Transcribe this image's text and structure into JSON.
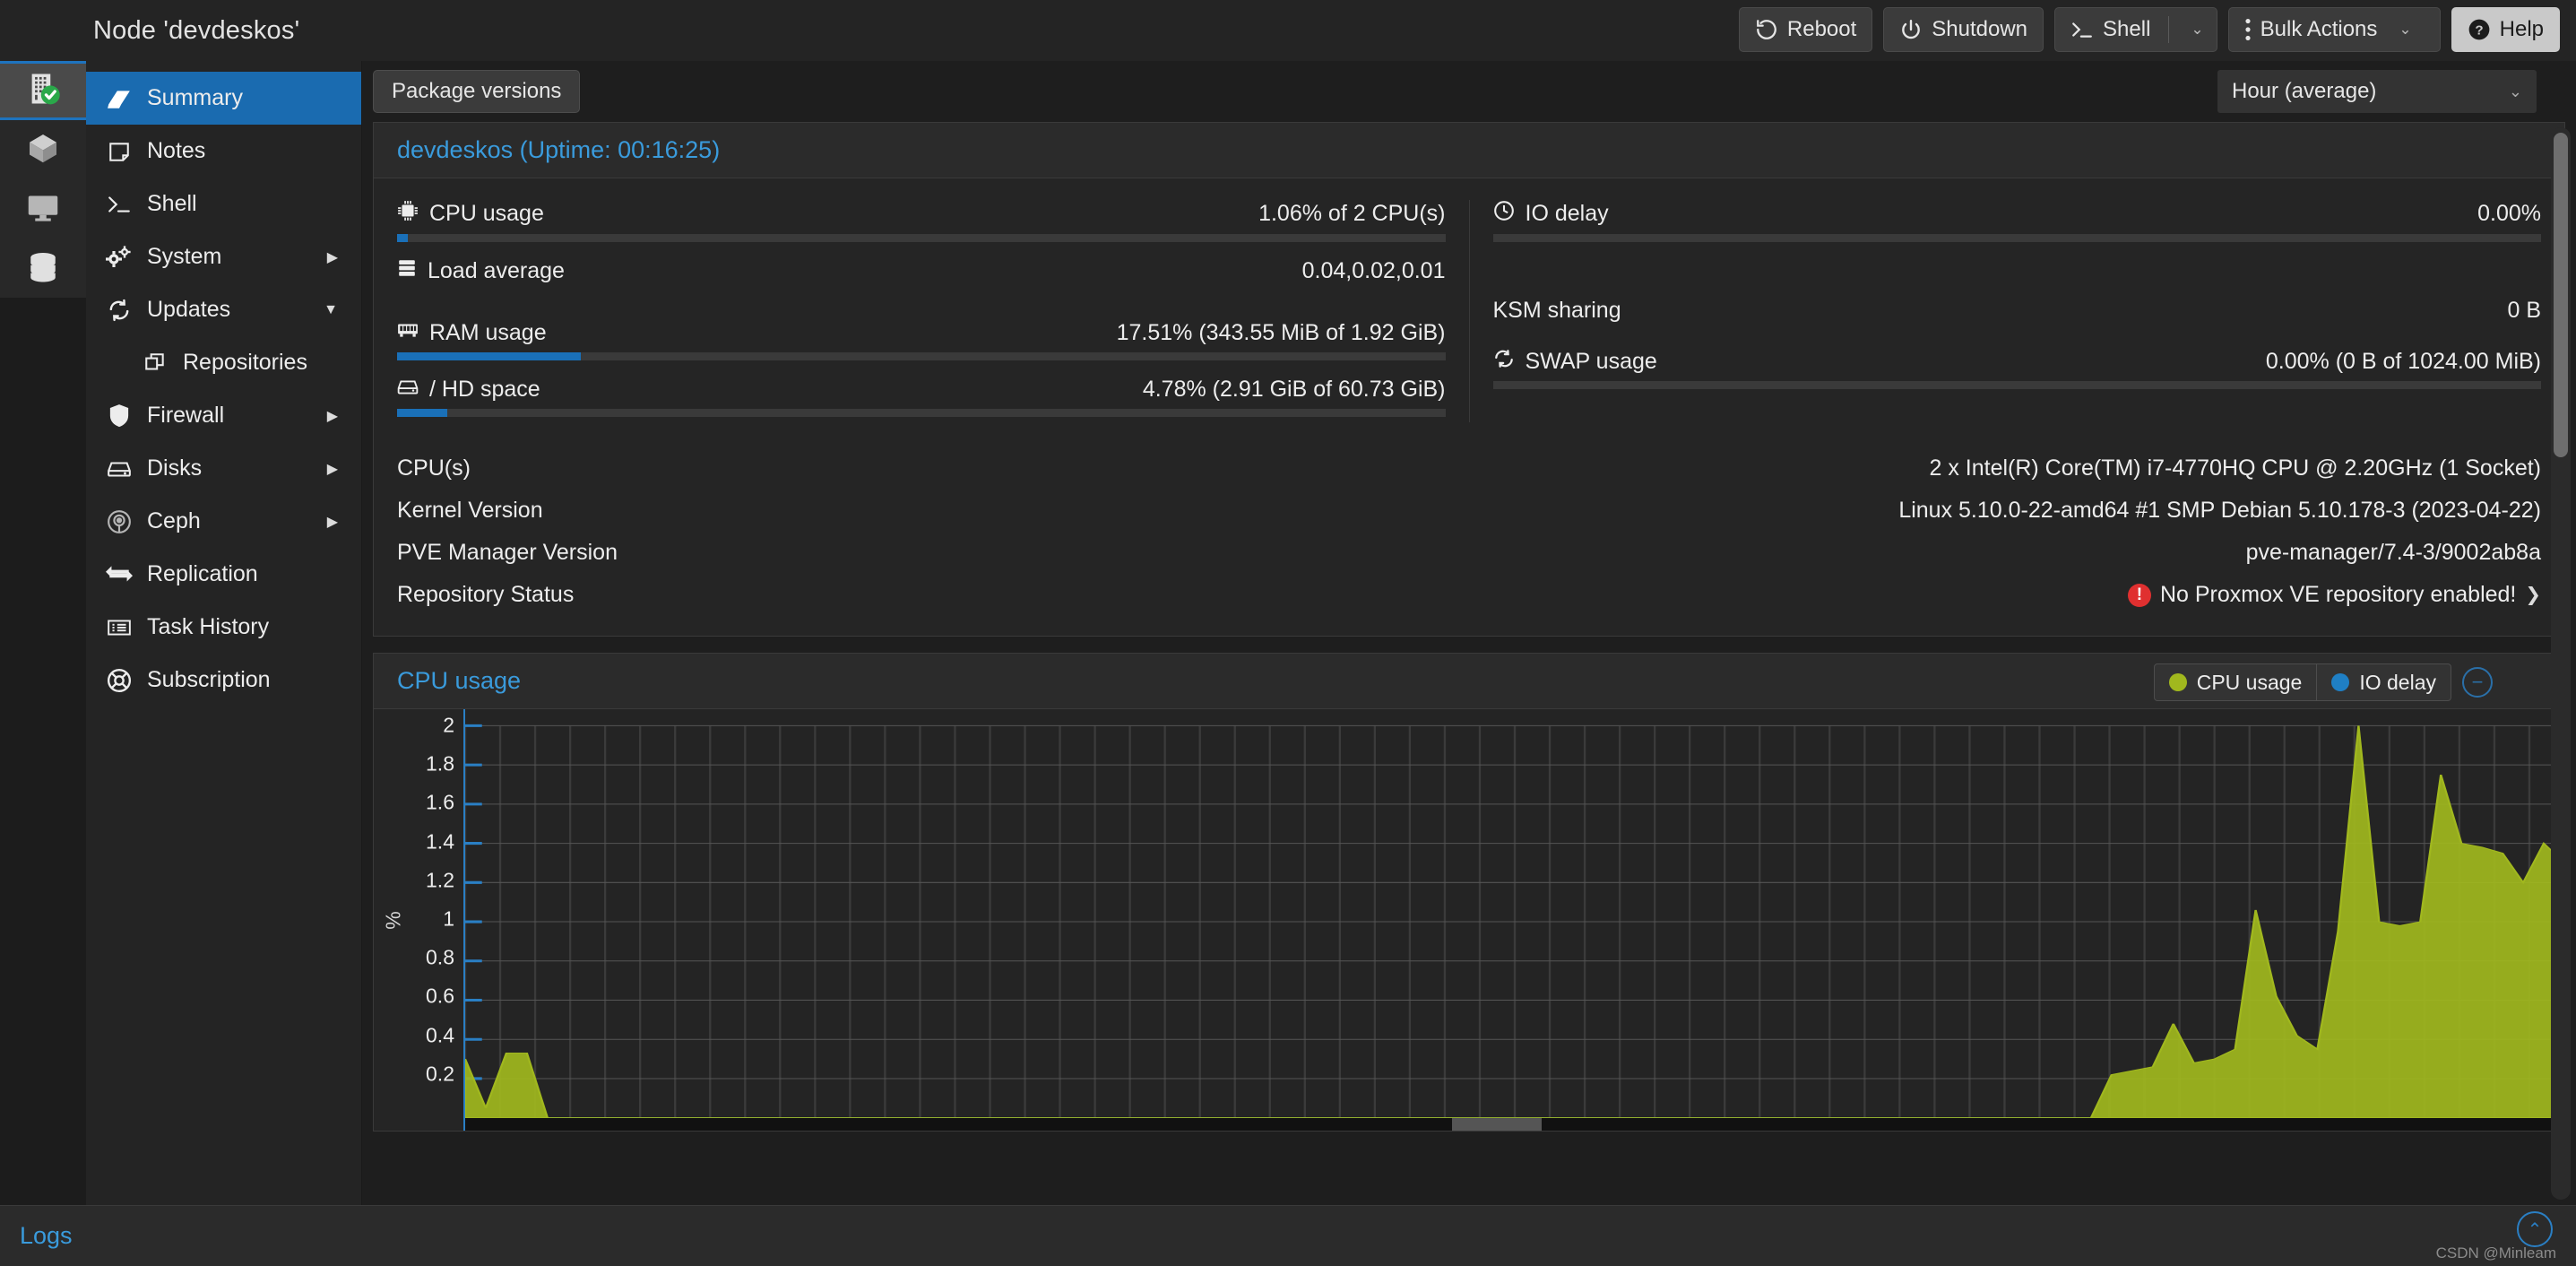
{
  "header": {
    "title": "Node 'devdeskos'",
    "buttons": [
      {
        "label": "Reboot",
        "icon": "reboot-icon"
      },
      {
        "label": "Shutdown",
        "icon": "power-icon"
      },
      {
        "label": "Shell",
        "icon": "terminal-icon",
        "split": true
      },
      {
        "label": "Bulk Actions",
        "icon": "kebab-icon",
        "caret": true
      },
      {
        "label": "Help",
        "icon": "question-icon",
        "primary": true
      }
    ],
    "caret_glyph": "⌄"
  },
  "rail": {
    "items": [
      {
        "name": "datacenter-icon",
        "active": true
      },
      {
        "name": "cube-icon",
        "active": false
      },
      {
        "name": "monitor-icon",
        "active": false
      },
      {
        "name": "storage-icon",
        "active": false
      }
    ]
  },
  "sidebar": {
    "items": [
      {
        "label": "Summary",
        "icon": "book-icon",
        "active": true,
        "arrow": ""
      },
      {
        "label": "Notes",
        "icon": "note-icon",
        "active": false,
        "arrow": ""
      },
      {
        "label": "Shell",
        "icon": "terminal-icon",
        "active": false,
        "arrow": ""
      },
      {
        "label": "System",
        "icon": "gears-icon",
        "active": false,
        "arrow": "▶"
      },
      {
        "label": "Updates",
        "icon": "refresh-icon",
        "active": false,
        "arrow": "▼"
      },
      {
        "label": "Repositories",
        "icon": "layers-icon",
        "active": false,
        "arrow": "",
        "sub": true
      },
      {
        "label": "Firewall",
        "icon": "shield-icon",
        "active": false,
        "arrow": "▶"
      },
      {
        "label": "Disks",
        "icon": "disk-icon",
        "active": false,
        "arrow": "▶"
      },
      {
        "label": "Ceph",
        "icon": "ceph-icon",
        "active": false,
        "arrow": "▶"
      },
      {
        "label": "Replication",
        "icon": "replication-icon",
        "active": false,
        "arrow": ""
      },
      {
        "label": "Task History",
        "icon": "list-icon",
        "active": false,
        "arrow": ""
      },
      {
        "label": "Subscription",
        "icon": "lifebuoy-icon",
        "active": false,
        "arrow": ""
      }
    ]
  },
  "toolbar": {
    "package_versions_label": "Package versions",
    "time_range_value": "Hour (average)",
    "time_range_caret": "⌄"
  },
  "status_panel": {
    "title": "devdeskos (Uptime: 00:16:25)",
    "left": [
      {
        "label": "CPU usage",
        "icon": "cpu-icon",
        "value": "1.06% of 2 CPU(s)",
        "bar": 1.06
      },
      {
        "label": "Load average",
        "icon": "server-icon",
        "value": "0.04,0.02,0.01",
        "bar": null
      },
      {
        "label": "RAM usage",
        "icon": "ram-icon",
        "value": "17.51% (343.55 MiB of 1.92 GiB)",
        "bar": 17.51
      },
      {
        "label": "/ HD space",
        "icon": "hdd-icon",
        "value": "4.78% (2.91 GiB of 60.73 GiB)",
        "bar": 4.78
      }
    ],
    "right": [
      {
        "label": "IO delay",
        "icon": "clock-icon",
        "value": "0.00%",
        "bar": 0
      },
      {
        "label": "KSM sharing",
        "icon": "",
        "value": "0 B",
        "bar": null
      },
      {
        "label": "SWAP usage",
        "icon": "swap-icon",
        "value": "0.00% (0 B of 1024.00 MiB)",
        "bar": 0
      }
    ],
    "info": [
      {
        "label": "CPU(s)",
        "value": "2 x Intel(R) Core(TM) i7-4770HQ CPU @ 2.20GHz (1 Socket)",
        "error": false
      },
      {
        "label": "Kernel Version",
        "value": "Linux 5.10.0-22-amd64 #1 SMP Debian 5.10.178-3 (2023-04-22)",
        "error": false
      },
      {
        "label": "PVE Manager Version",
        "value": "pve-manager/7.4-3/9002ab8a",
        "error": false
      },
      {
        "label": "Repository Status",
        "value": "No Proxmox VE repository enabled!",
        "error": true,
        "chevron": "❯"
      }
    ]
  },
  "chart_panel": {
    "title": "CPU usage",
    "legend": [
      {
        "label": "CPU usage",
        "color": "#a1b81e"
      },
      {
        "label": "IO delay",
        "color": "#1f7fc4"
      }
    ],
    "collapse_glyph": "−"
  },
  "chart_data": {
    "type": "area",
    "title": "CPU usage",
    "ylabel": "%",
    "xlabel": "",
    "ylim": [
      0,
      2
    ],
    "yticks": [
      2,
      1.8,
      1.6,
      1.4,
      1.2,
      1,
      0.8,
      0.6,
      0.4,
      0.2
    ],
    "grid": true,
    "legend_position": "top-right",
    "series": [
      {
        "name": "CPU usage",
        "color": "#a1b81e",
        "values": [
          0.3,
          0.05,
          0.33,
          0.33,
          0,
          0,
          0,
          0,
          0,
          0,
          0,
          0,
          0,
          0,
          0,
          0,
          0,
          0,
          0,
          0,
          0,
          0,
          0,
          0,
          0,
          0,
          0,
          0,
          0,
          0,
          0,
          0,
          0,
          0,
          0,
          0,
          0,
          0,
          0,
          0,
          0,
          0,
          0,
          0,
          0,
          0,
          0,
          0,
          0,
          0,
          0,
          0,
          0,
          0,
          0,
          0,
          0,
          0,
          0,
          0,
          0,
          0,
          0,
          0,
          0,
          0,
          0,
          0,
          0,
          0,
          0,
          0,
          0,
          0,
          0,
          0,
          0,
          0,
          0,
          0,
          0.22,
          0.24,
          0.26,
          0.48,
          0.28,
          0.3,
          0.35,
          1.06,
          0.62,
          0.42,
          0.35,
          0.95,
          2.0,
          1.0,
          0.98,
          1.0,
          1.75,
          1.4,
          1.38,
          1.35,
          1.2,
          1.4,
          1.3
        ]
      },
      {
        "name": "IO delay",
        "color": "#1f7fc4",
        "values": [
          0,
          0,
          0,
          0,
          0,
          0,
          0,
          0,
          0,
          0,
          0,
          0,
          0,
          0,
          0,
          0,
          0,
          0,
          0,
          0,
          0,
          0,
          0,
          0,
          0,
          0,
          0,
          0,
          0,
          0,
          0,
          0,
          0,
          0,
          0,
          0,
          0,
          0,
          0,
          0,
          0,
          0,
          0,
          0,
          0,
          0,
          0,
          0,
          0,
          0,
          0,
          0,
          0,
          0,
          0,
          0,
          0,
          0,
          0,
          0,
          0,
          0,
          0,
          0,
          0,
          0,
          0,
          0,
          0,
          0,
          0,
          0,
          0,
          0,
          0,
          0,
          0,
          0,
          0,
          0,
          0,
          0,
          0,
          0,
          0,
          0,
          0,
          0,
          0,
          0,
          0,
          0,
          0,
          0,
          0,
          0,
          0,
          0,
          0,
          0,
          0,
          0,
          0
        ]
      }
    ]
  },
  "footer": {
    "logs_label": "Logs",
    "watermark": "CSDN @Minleam",
    "up_glyph": "⌃"
  }
}
